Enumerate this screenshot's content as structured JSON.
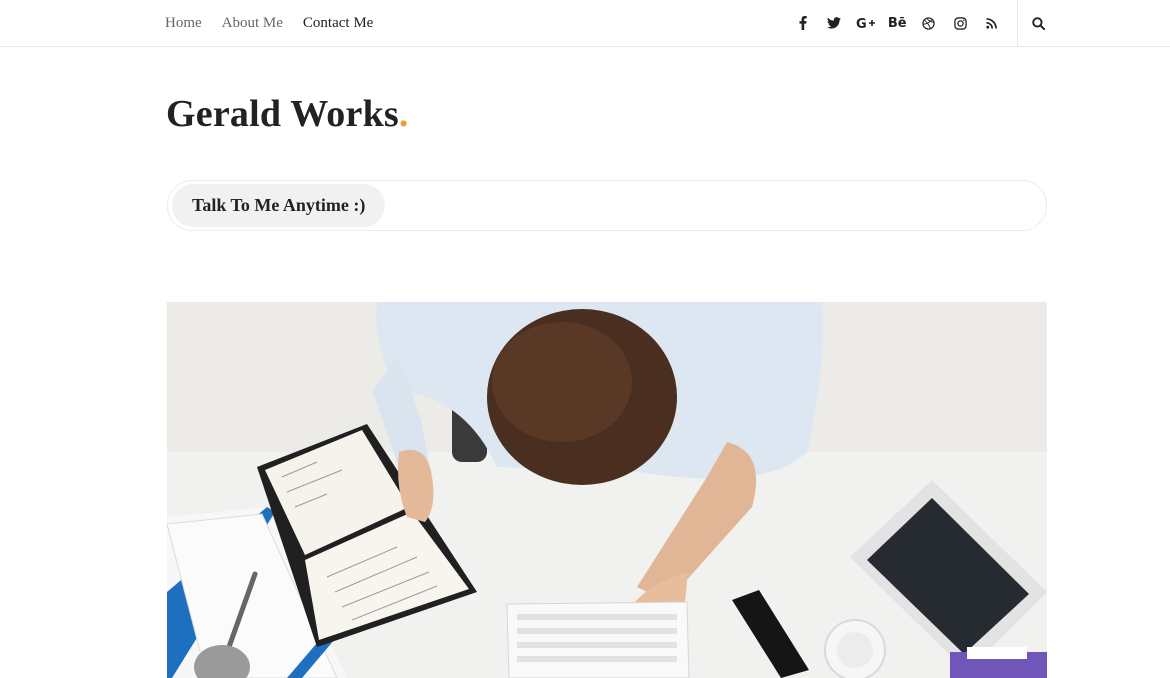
{
  "nav": {
    "items": [
      {
        "label": "Home"
      },
      {
        "label": "About Me"
      },
      {
        "label": "Contact Me"
      }
    ]
  },
  "social": {
    "icons": [
      "facebook-icon",
      "twitter-icon",
      "google-plus-icon",
      "behance-icon",
      "dribbble-icon",
      "instagram-icon",
      "rss-icon"
    ],
    "behance_label": "Bē"
  },
  "site": {
    "title": "Gerald Works",
    "title_dot": ".",
    "accent": "#e8a13a",
    "tagline": "Talk To Me Anytime :)"
  }
}
